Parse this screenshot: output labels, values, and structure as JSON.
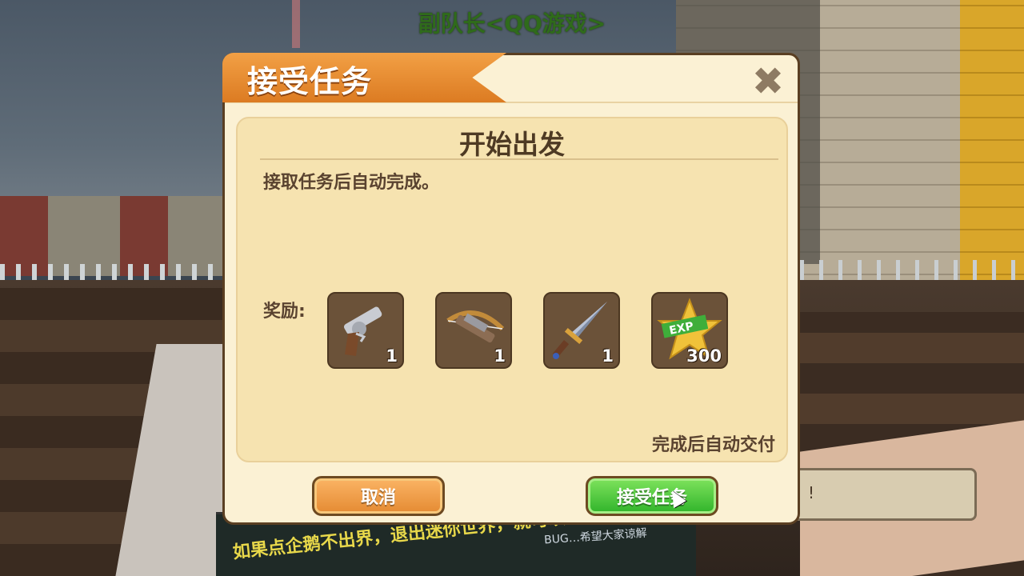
{
  "hud": {
    "player_name": "副队长<QQ游戏>"
  },
  "background": {
    "sign_text": "如果点企鹅不出界，退出迷你世界，就可以了",
    "sign_text_small": "BUG…希望大家谅解",
    "chat_text": "：!"
  },
  "dialog": {
    "title": "接受任务",
    "close_icon": "close-icon",
    "quest_title": "开始出发",
    "description": "接取任务后自动完成。",
    "reward_label": "奖励:",
    "rewards": [
      {
        "name": "revolver",
        "icon": "revolver-icon",
        "count": "1"
      },
      {
        "name": "crossbow",
        "icon": "crossbow-icon",
        "count": "1"
      },
      {
        "name": "dagger",
        "icon": "dagger-icon",
        "count": "1"
      },
      {
        "name": "exp",
        "icon": "exp-star-icon",
        "count": "300"
      }
    ],
    "footer_note": "完成后自动交付",
    "cancel_label": "取消",
    "accept_label": "接受任务"
  },
  "colors": {
    "banner": "#e68a2e",
    "panel": "#f6e3b0",
    "cancel": "#f09c45",
    "accept": "#4cc83d"
  }
}
